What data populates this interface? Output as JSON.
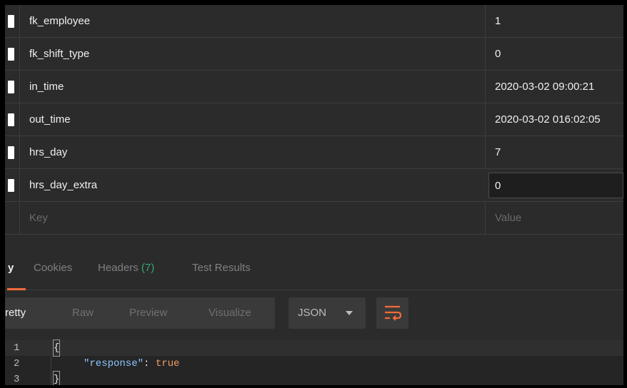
{
  "params": {
    "rows": [
      {
        "key": "fk_employee",
        "value": "1"
      },
      {
        "key": "fk_shift_type",
        "value": "0"
      },
      {
        "key": "in_time",
        "value": "2020-03-02 09:00:21"
      },
      {
        "key": "out_time",
        "value": "2020-03-02 016:02:05"
      },
      {
        "key": "hrs_day",
        "value": "7"
      },
      {
        "key": "hrs_day_extra",
        "value": "0"
      }
    ],
    "new_row": {
      "key_placeholder": "Key",
      "value_placeholder": "Value"
    }
  },
  "response_tabs": {
    "active_partial": "y",
    "cookies": "Cookies",
    "headers": "Headers",
    "headers_count": "(7)",
    "test_results": "Test Results"
  },
  "view_modes": {
    "pretty": "retty",
    "raw": "Raw",
    "preview": "Preview",
    "visualize": "Visualize"
  },
  "format": {
    "selected": "JSON"
  },
  "code": {
    "lines": [
      {
        "number": "1",
        "text": "{"
      },
      {
        "number": "2",
        "key": "\"response\"",
        "colon": ": ",
        "value": "true"
      },
      {
        "number": "3",
        "text": "}"
      }
    ]
  },
  "colors": {
    "accent": "#f26b3a",
    "count": "#35a66f",
    "json_key": "#8ec6ff",
    "json_value": "#f29c67",
    "background": "#2b2b2b"
  }
}
